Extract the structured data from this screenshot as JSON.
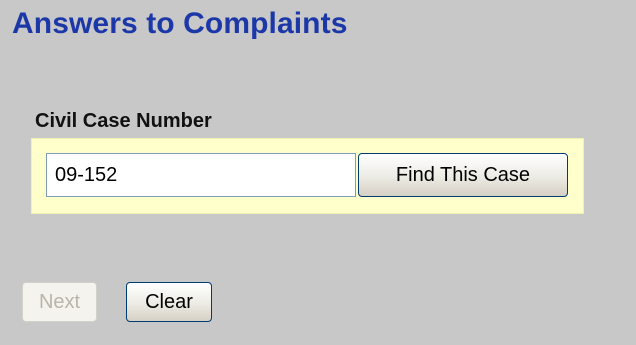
{
  "page": {
    "title": "Answers to Complaints"
  },
  "case_search": {
    "label": "Civil Case Number",
    "input_value": "09-152",
    "find_button_label": "Find This Case"
  },
  "actions": {
    "next_label": "Next",
    "clear_label": "Clear"
  },
  "colors": {
    "title": "#1c38a8",
    "background": "#c8c8c8",
    "highlight_box": "#ffffcc",
    "disabled_text": "#b8b5ab"
  }
}
